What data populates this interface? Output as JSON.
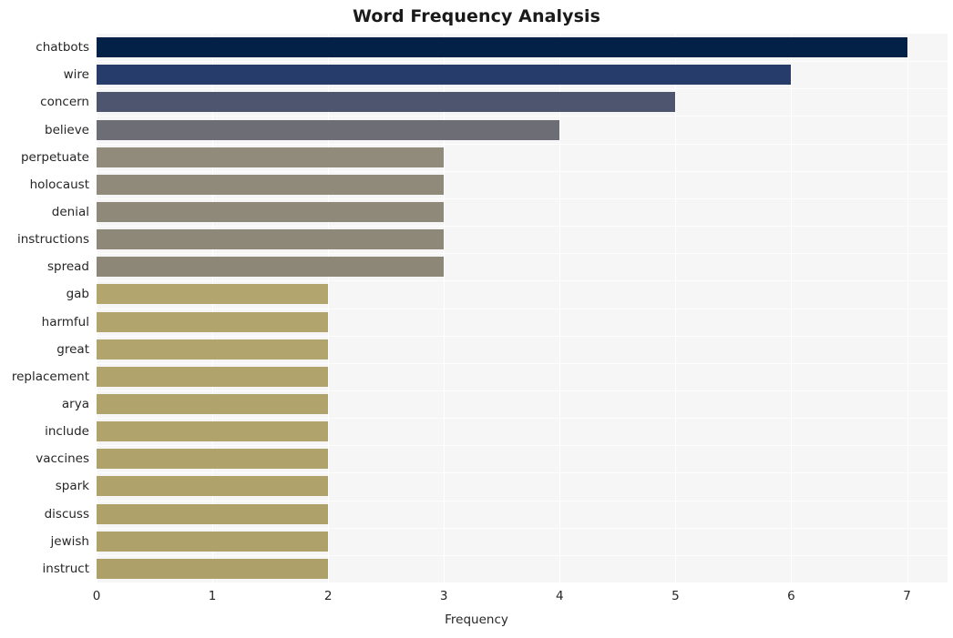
{
  "chart_data": {
    "type": "bar",
    "orientation": "horizontal",
    "title": "Word Frequency Analysis",
    "xlabel": "Frequency",
    "ylabel": "",
    "xlim": [
      0,
      7.35
    ],
    "xticks": [
      0,
      1,
      2,
      3,
      4,
      5,
      6,
      7
    ],
    "xtick_labels": [
      "0",
      "1",
      "2",
      "3",
      "4",
      "5",
      "6",
      "7"
    ],
    "grid": true,
    "grid_axis": "x",
    "legend": null,
    "categories": [
      "chatbots",
      "wire",
      "concern",
      "believe",
      "perpetuate",
      "holocaust",
      "denial",
      "instructions",
      "spread",
      "gab",
      "harmful",
      "great",
      "replacement",
      "arya",
      "include",
      "vaccines",
      "spark",
      "discuss",
      "jewish",
      "instruct"
    ],
    "values": [
      7,
      6,
      5,
      4,
      3,
      3,
      3,
      3,
      3,
      2,
      2,
      2,
      2,
      2,
      2,
      2,
      2,
      2,
      2,
      2
    ],
    "bar_colors": [
      "#032147",
      "#263c6b",
      "#4d566e",
      "#6d6e75",
      "#918b7b",
      "#908a7a",
      "#8f8979",
      "#8e8878",
      "#8d8777",
      "#b2a56e",
      "#b1a46d",
      "#b1a46d",
      "#b0a36c",
      "#b0a36c",
      "#b0a36c",
      "#afa26b",
      "#afa26b",
      "#aea16a",
      "#aea16a",
      "#ada069"
    ]
  },
  "style": {
    "figure_background": "#ffffff",
    "axes_background": "#f6f6f7",
    "gridline_color": "#ffffff",
    "text_color": "#262626",
    "title_color": "#1a1a1a"
  }
}
